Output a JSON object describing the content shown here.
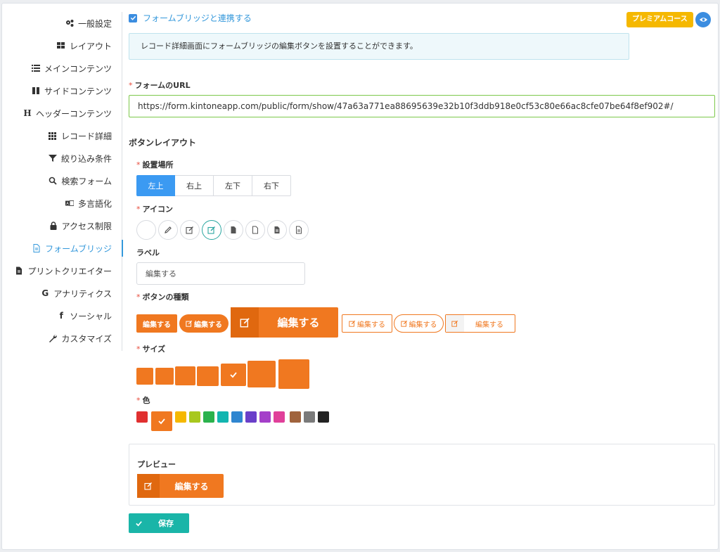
{
  "sidebar": {
    "items": [
      {
        "label": "一般設定",
        "icon": "gears-icon"
      },
      {
        "label": "レイアウト",
        "icon": "grid-icon"
      },
      {
        "label": "メインコンテンツ",
        "icon": "list-icon"
      },
      {
        "label": "サイドコンテンツ",
        "icon": "columns-icon"
      },
      {
        "label": "ヘッダーコンテンツ",
        "icon": "header-icon"
      },
      {
        "label": "レコード詳細",
        "icon": "th-icon"
      },
      {
        "label": "絞り込み条件",
        "icon": "filter-icon"
      },
      {
        "label": "検索フォーム",
        "icon": "search-icon"
      },
      {
        "label": "多言語化",
        "icon": "language-icon"
      },
      {
        "label": "アクセス制限",
        "icon": "lock-icon"
      },
      {
        "label": "フォームブリッジ",
        "icon": "file-icon",
        "active": true
      },
      {
        "label": "プリントクリエイター",
        "icon": "file-text-icon"
      },
      {
        "label": "アナリティクス",
        "icon": "google-icon"
      },
      {
        "label": "ソーシャル",
        "icon": "facebook-icon"
      },
      {
        "label": "カスタマイズ",
        "icon": "wrench-icon"
      }
    ]
  },
  "main": {
    "enable_label": "フォームブリッジと連携する",
    "premium_badge": "プレミアムコース",
    "info_text": "レコード詳細画面にフォームブリッジの編集ボタンを設置することができます。",
    "url_label": "フォームのURL",
    "url_value": "https://form.kintoneapp.com/public/form/show/47a63a771ea88695639e32b10f3ddb918e0cf53c80e66ac8cfe07be64f8ef902#/",
    "button_layout_title": "ボタンレイアウト",
    "position_label": "設置場所",
    "positions": [
      "左上",
      "右上",
      "左下",
      "右下"
    ],
    "icon_label": "アイコン",
    "label_label": "ラベル",
    "label_value": "編集する",
    "button_type_label": "ボタンの種類",
    "button_type_text": "編集する",
    "size_label": "サイズ",
    "color_label": "色",
    "colors": [
      "#e03030",
      "#f07820",
      "#f5b800",
      "#a8c81e",
      "#2bb24c",
      "#12b5b0",
      "#2f86d0",
      "#6a3fc9",
      "#a43fc9",
      "#e0409a",
      "#a0633c",
      "#7a7a7a",
      "#222222"
    ],
    "preview_label": "プレビュー",
    "preview_button": "編集する",
    "save_label": "保存"
  }
}
